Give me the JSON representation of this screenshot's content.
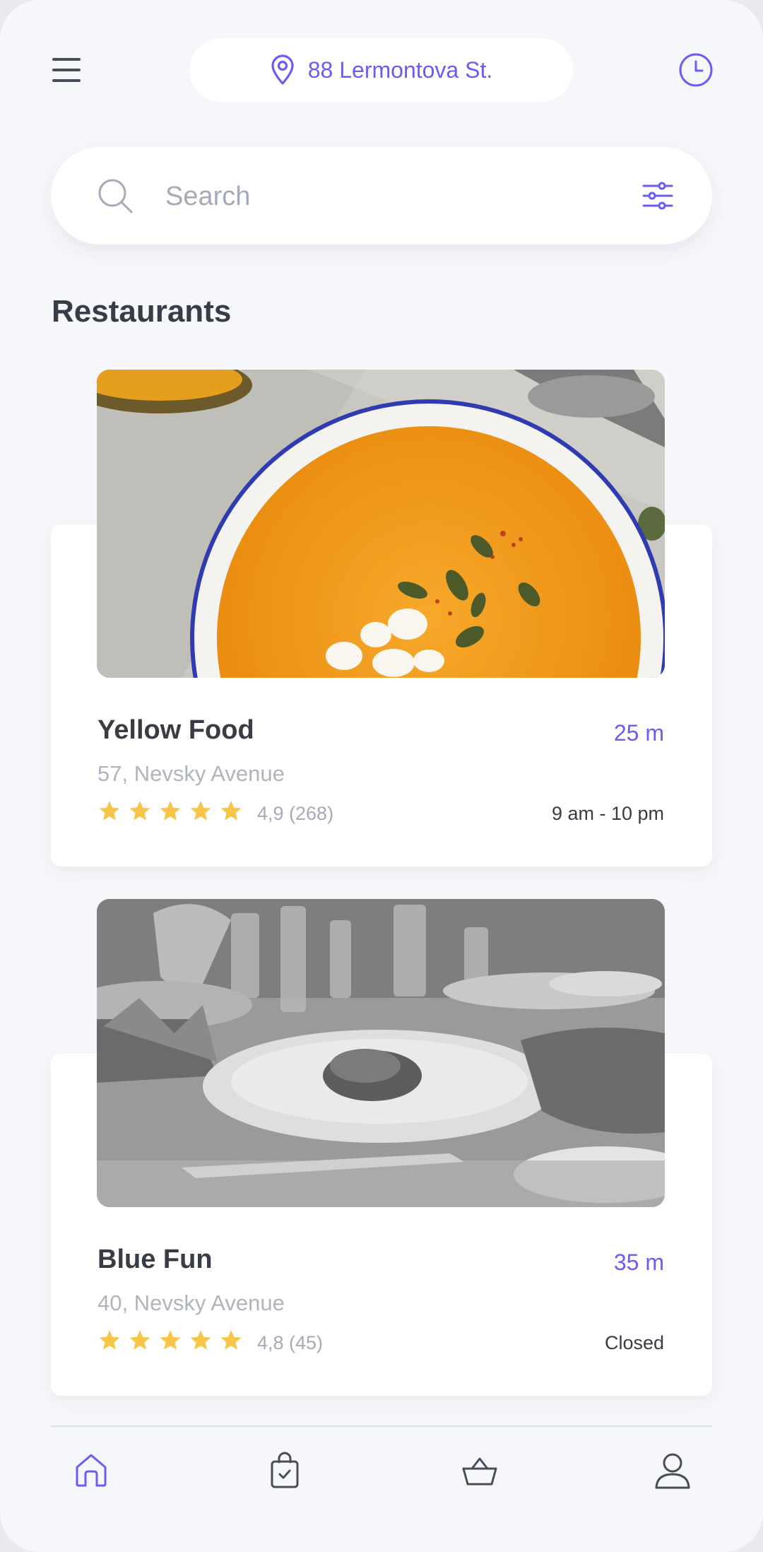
{
  "header": {
    "location": "88 Lermontova St."
  },
  "search": {
    "placeholder": "Search"
  },
  "section": {
    "title": "Restaurants"
  },
  "restaurants": [
    {
      "name": "Yellow Food",
      "distance": "25 m",
      "address": "57, Nevsky Avenue",
      "stars": 5,
      "rating": "4,9 (268)",
      "hours": "9 am - 10 pm",
      "image": "bowl of pumpkin soup with seeds and feta"
    },
    {
      "name": "Blue Fun",
      "distance": "35 m",
      "address": "40, Nevsky Avenue",
      "stars": 5,
      "rating": "4,8 (45)",
      "hours": "Closed",
      "image": "grayscale restaurant table with plated dish"
    }
  ],
  "bottom_nav": {
    "items": [
      "home-icon",
      "shopping-bag-icon",
      "basket-icon",
      "profile-icon"
    ],
    "active": "home-icon"
  },
  "colors": {
    "accent": "#6a5cf6",
    "star": "#f7c548",
    "text_dark": "#393c46",
    "text_muted": "#b0b3c0",
    "background": "#f6f7fa"
  }
}
